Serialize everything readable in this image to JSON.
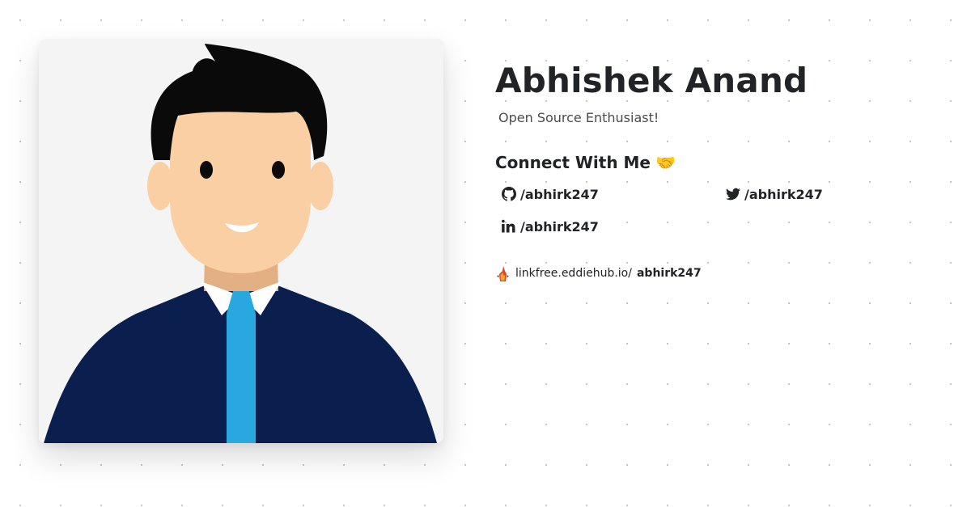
{
  "profile": {
    "name": "Abhishek Anand",
    "tagline": "Open Source Enthusiast!",
    "avatar_icon": "person-avatar-illustration"
  },
  "connect": {
    "heading": "Connect With Me",
    "emoji": "🤝",
    "links": [
      {
        "icon": "github-icon",
        "label": "/abhirk247"
      },
      {
        "icon": "twitter-icon",
        "label": "/abhirk247"
      },
      {
        "icon": "linkedin-icon",
        "label": "/abhirk247"
      }
    ]
  },
  "linkfree": {
    "icon": "linkfree-logo-icon",
    "domain": "linkfree.eddiehub.io/",
    "username": "abhirk247"
  },
  "colors": {
    "text": "#222326",
    "muted": "#4a4a4a",
    "suit": "#0b1f4f",
    "tie": "#29a8e0",
    "skin": "#f9cfa3",
    "hair": "#0a0a0a"
  }
}
